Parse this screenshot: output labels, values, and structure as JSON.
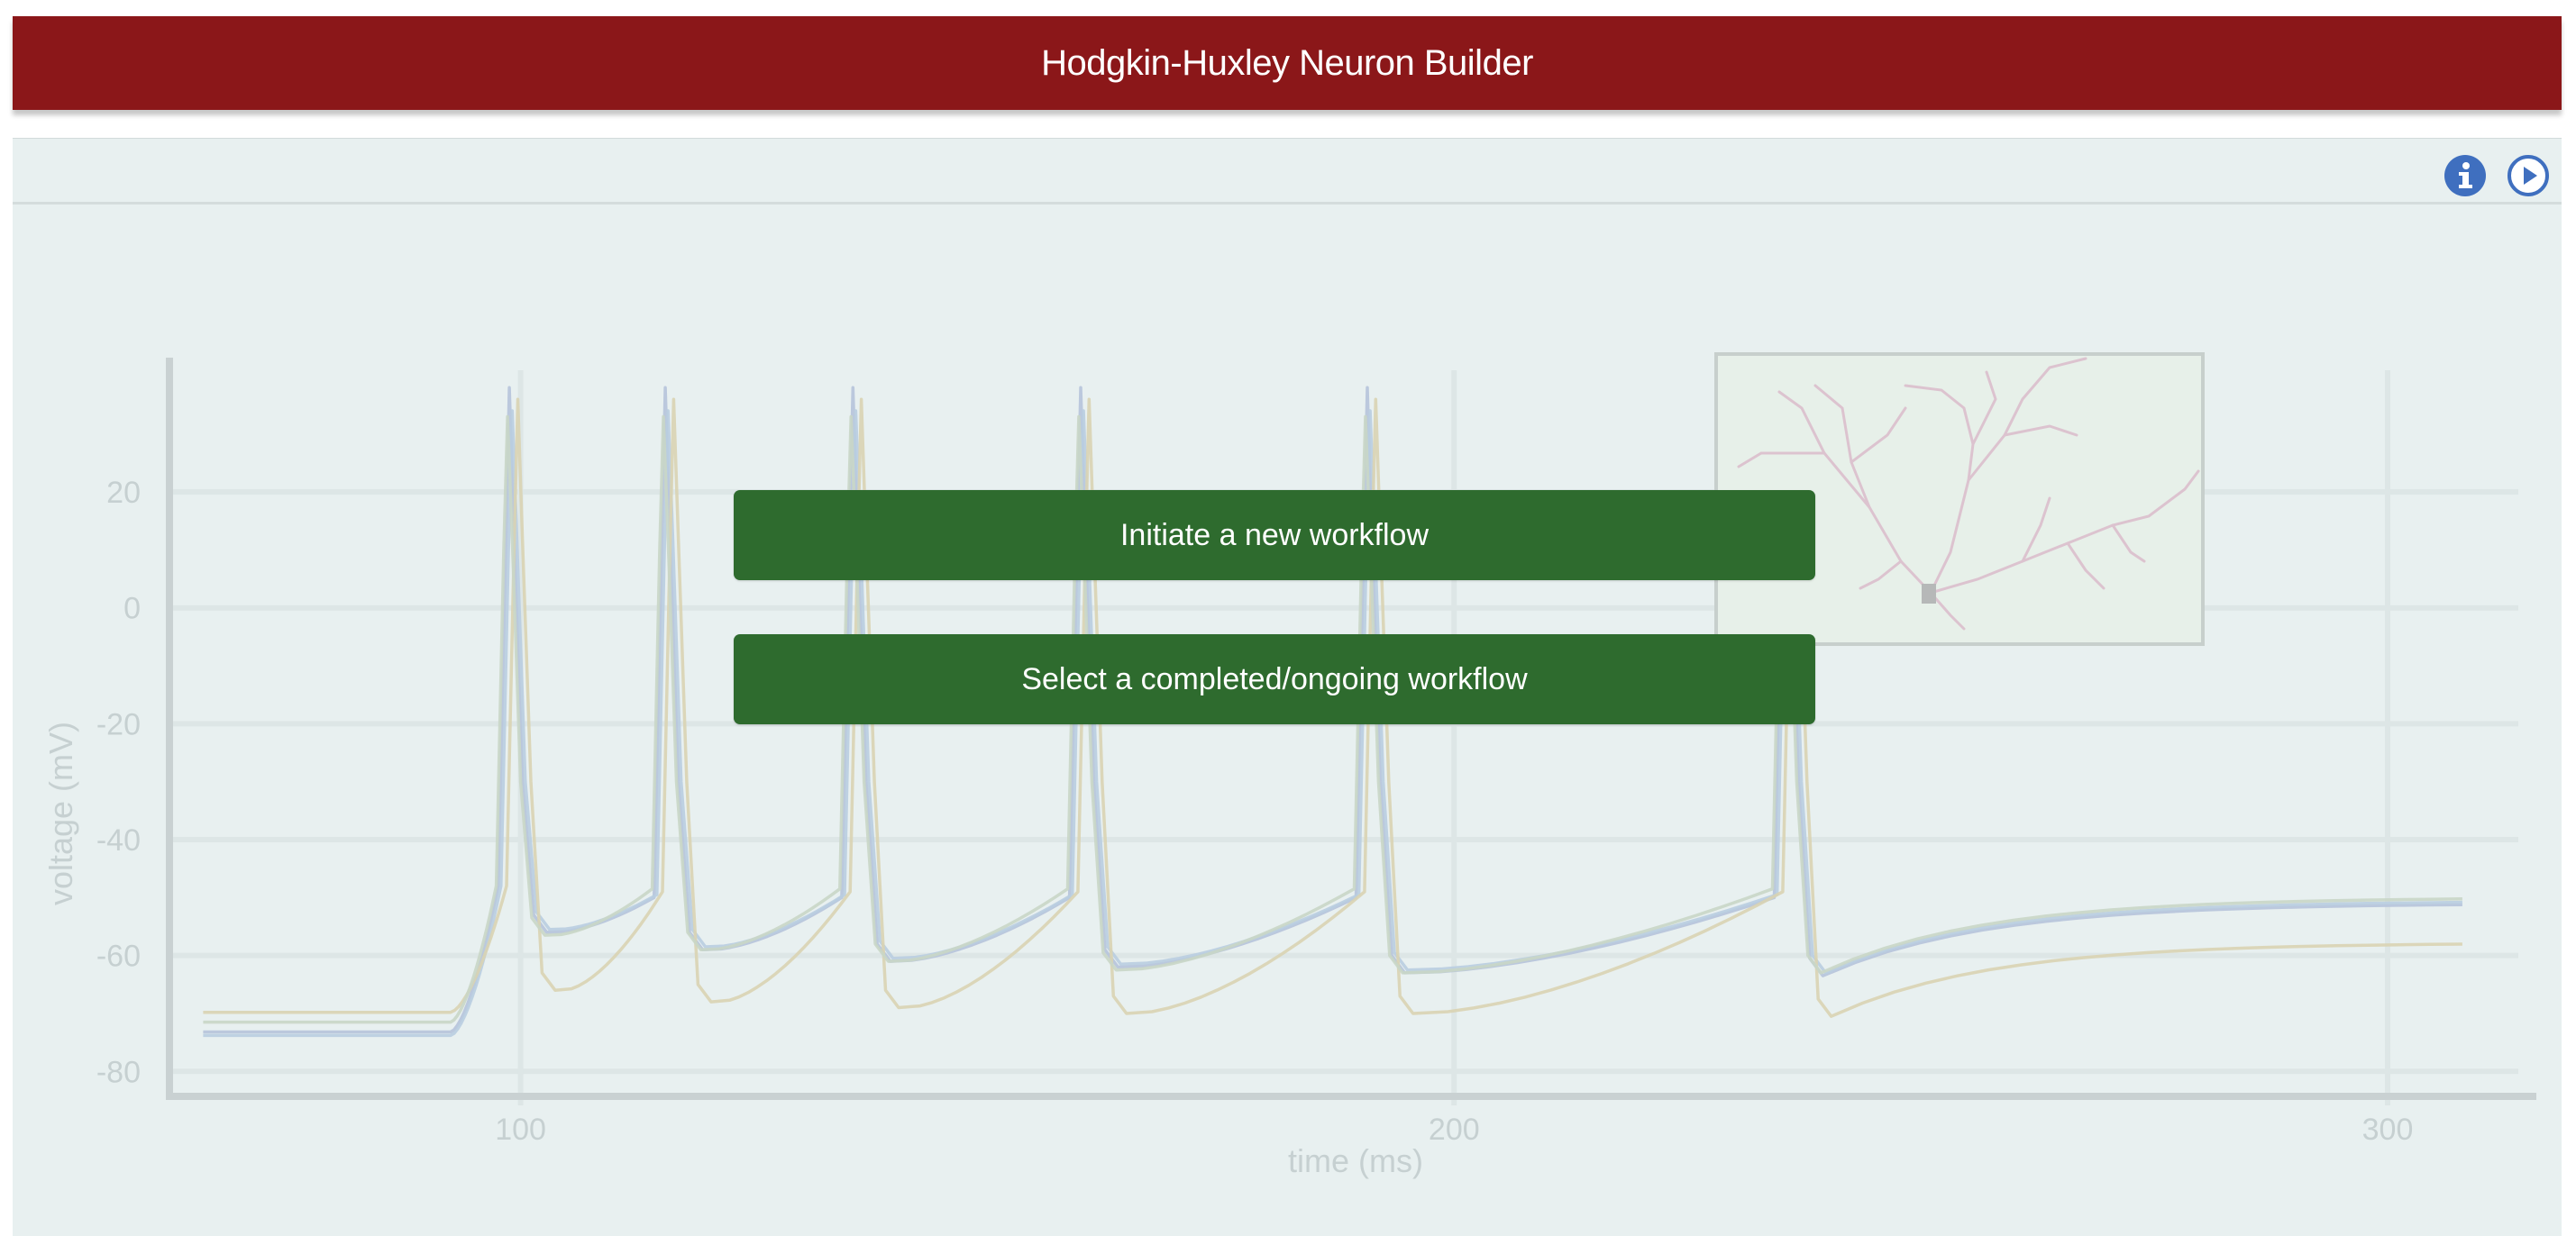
{
  "header": {
    "title": "Hodgkin-Huxley Neuron Builder"
  },
  "toolbar": {
    "info_icon": "info-icon",
    "play_icon": "play-circle-icon"
  },
  "actions": {
    "new_workflow_label": "Initiate a new workflow",
    "select_workflow_label": "Select a completed/ongoing workflow"
  },
  "colors": {
    "header": "#8b1719",
    "background": "#e8f0f0",
    "button": "#2e6b2e",
    "icon": "#3f6fbf"
  },
  "chart_data": {
    "type": "line",
    "xlabel": "time (ms)",
    "ylabel": "voltage (mV)",
    "xlim": [
      62,
      314
    ],
    "ylim": [
      -84,
      41
    ],
    "x_ticks": [
      "100",
      "200",
      "300"
    ],
    "y_ticks": [
      "20",
      "0",
      "-20",
      "-40",
      "-60",
      "-80"
    ],
    "grid": true,
    "spike_times": [
      98.8,
      115.5,
      135.6,
      160,
      190.7,
      235.5
    ],
    "series": [
      {
        "color": "#b6c3da",
        "rest": -73.2,
        "end": -51,
        "troughs": [
          -56,
          -59,
          -61,
          -62,
          -63,
          -63.5
        ],
        "peak": 38,
        "shift": 0
      },
      {
        "color": "#b9cde0",
        "rest": -73.8,
        "end": -50.6,
        "troughs": [
          -55.5,
          -58.5,
          -60.5,
          -61.5,
          -62.5,
          -63
        ],
        "peak": 34,
        "shift": 0.3
      },
      {
        "color": "#d9d3b3",
        "rest": -69.8,
        "end": -57.8,
        "troughs": [
          -66,
          -68,
          -69,
          -70,
          -70,
          -70.5
        ],
        "peak": 36,
        "shift": 0.9
      },
      {
        "color": "#c9d6c6",
        "rest": -71.5,
        "end": -50,
        "troughs": [
          -56.5,
          -59,
          -61,
          -62.5,
          -63,
          -63
        ],
        "peak": 33,
        "shift": -0.2
      }
    ]
  }
}
